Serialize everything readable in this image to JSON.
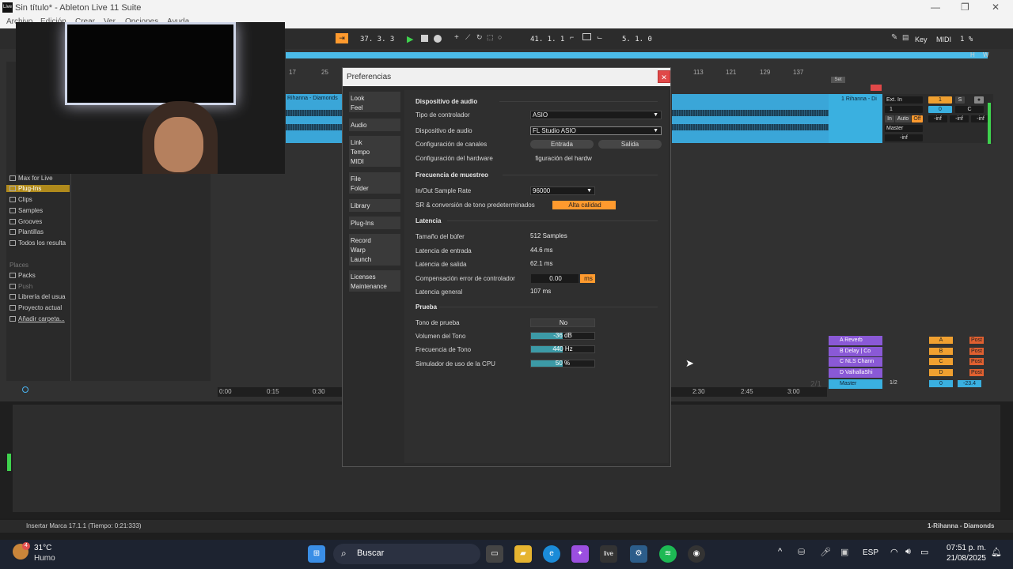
{
  "window": {
    "title": "Sin título* - Ableton Live 11 Suite",
    "minimize": "—",
    "maximize": "❐",
    "close": "✕"
  },
  "menu": [
    "Archivo",
    "Edición",
    "Crear",
    "Ver",
    "Opciones",
    "Ayuda"
  ],
  "transport": {
    "arrangement_position": "37.  3.  3",
    "loop_start": "41.  1.  1",
    "loop_length": "5.  1.  0",
    "key_label": "Key",
    "midi_label": "MIDI",
    "cpu_load": "1 %",
    "h_label": "H",
    "w_label": "W"
  },
  "browser": {
    "categories": [
      "Max for Live",
      "Plug-Ins",
      "Clips",
      "Samples",
      "Grooves",
      "Plantillas",
      "Todos los resulta"
    ],
    "places_header": "Places",
    "places": [
      "Packs",
      "Push",
      "Librería del usua",
      "Proyecto actual",
      "Añadir carpeta..."
    ]
  },
  "ruler": [
    "17",
    "25",
    "113",
    "121",
    "129",
    "137"
  ],
  "clips": {
    "main_clip": "Rihanna - Diamonds"
  },
  "tracks": {
    "set_label": "Set",
    "audio_track": "1 Rihanna - Di",
    "input": "Ext. In",
    "input_channel": "1",
    "monitor_in": "In",
    "monitor_auto": "Auto",
    "monitor_off": "Off",
    "output": "Master",
    "track_number": "1",
    "solo": "S",
    "volume": "0",
    "pan": "C",
    "meter_values": [
      "-inf",
      "-inf",
      "-inf",
      "-inf"
    ],
    "returns": [
      {
        "name": "A Reverb",
        "letter": "A"
      },
      {
        "name": "B Delay | Co",
        "letter": "B"
      },
      {
        "name": "C NLS Chann",
        "letter": "C"
      },
      {
        "name": "D ValhallaShi",
        "letter": "D"
      }
    ],
    "post_label": "Post",
    "master": {
      "name": "Master",
      "cue": "1/2",
      "volume": "0",
      "peak": "-23.4"
    },
    "page_indicator": "2/1"
  },
  "timeline": [
    "0:00",
    "0:15",
    "0:30",
    "2:30",
    "2:45",
    "3:00"
  ],
  "status": {
    "message": "Insertar Marca 17.1.1 (Tiempo: 0:21:333)",
    "selected_clip": "1-Rihanna - Diamonds"
  },
  "dialog": {
    "title": "Preferencias",
    "close": "✕",
    "tabs": [
      [
        "Look",
        "Feel"
      ],
      [
        "Audio"
      ],
      [
        "Link",
        "Tempo",
        "MIDI"
      ],
      [
        "File",
        "Folder"
      ],
      [
        "Library"
      ],
      [
        "Plug-Ins"
      ],
      [
        "Record",
        "Warp",
        "Launch"
      ],
      [
        "Licenses",
        "Maintenance"
      ]
    ],
    "sections": {
      "device": "Dispositivo de audio",
      "sample_rate": "Frecuencia de muestreo",
      "latency": "Latencia",
      "test": "Prueba"
    },
    "driver_type_label": "Tipo de controlador",
    "driver_type": "ASIO",
    "audio_device_label": "Dispositivo de audio",
    "audio_device": "FL Studio ASIO",
    "channel_config_label": "Configuración de canales",
    "input_button": "Entrada",
    "output_button": "Salida",
    "hardware_config_label": "Configuración del hardware",
    "hardware_config_button": "figuración del hardw",
    "in_out_rate_label": "In/Out Sample Rate",
    "in_out_rate": "96000",
    "sr_conversion_label": "SR & conversión de tono predeterminados",
    "sr_conversion": "Alta calidad",
    "buffer_label": "Tamaño del búfer",
    "buffer": "512 Samples",
    "input_latency_label": "Latencia de entrada",
    "input_latency": "44.6 ms",
    "output_latency_label": "Latencia de salida",
    "output_latency": "62.1 ms",
    "driver_error_label": "Compensación error de controlador",
    "driver_error": "0.00",
    "driver_error_unit": "ms",
    "overall_latency_label": "Latencia general",
    "overall_latency": "107 ms",
    "test_tone_label": "Tono de prueba",
    "test_tone": "No",
    "tone_volume_label": "Volumen del Tono",
    "tone_volume": "-36 dB",
    "tone_volume_fraction": 0.5,
    "tone_frequency_label": "Frecuencia de Tono",
    "tone_frequency": "440 Hz",
    "tone_frequency_fraction": 0.5,
    "cpu_sim_label": "Simulador de uso de la CPU",
    "cpu_sim": "50 %",
    "cpu_sim_fraction": 0.5
  },
  "taskbar": {
    "weather_temp": "31°C",
    "weather_desc": "Humo",
    "weather_badge": "4",
    "search_placeholder": "Buscar",
    "lang": "ESP",
    "time": "07:51 p. m.",
    "date": "21/08/2025",
    "live_label": "live"
  },
  "colors": {
    "accent_orange": "#ff9a2e",
    "clip_blue": "#3aa6d8",
    "return_purple": "#8a59d6",
    "dialog_bg": "#2b2b2b"
  }
}
